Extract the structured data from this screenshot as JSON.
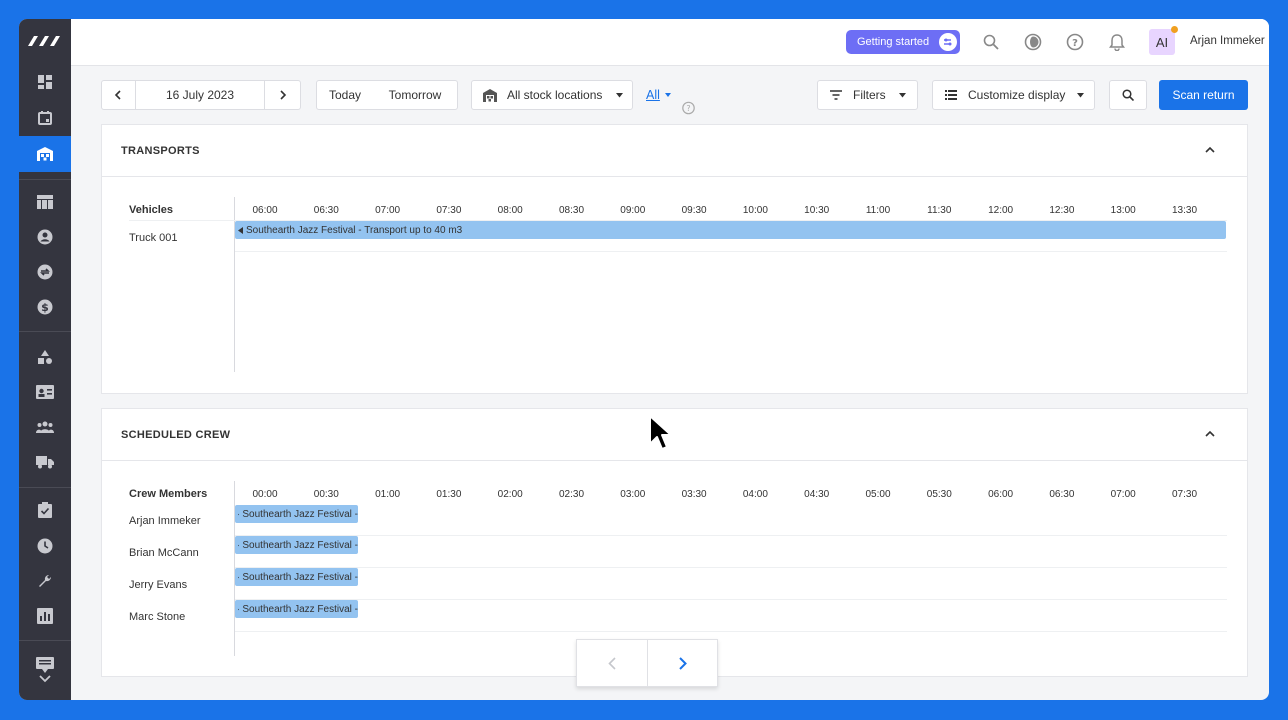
{
  "topbar": {
    "getting_started": "Getting started",
    "avatar_initials": "AI",
    "user_name": "Arjan Immeker"
  },
  "toolbar": {
    "date": "16 July 2023",
    "today": "Today",
    "tomorrow": "Tomorrow",
    "stock_locations": "All stock locations",
    "all_filter": "All",
    "filters": "Filters",
    "customize_display": "Customize display",
    "scan_return": "Scan return"
  },
  "transports": {
    "title": "TRANSPORTS",
    "row_header": "Vehicles",
    "times": [
      "06:00",
      "06:30",
      "07:00",
      "07:30",
      "08:00",
      "08:30",
      "09:00",
      "09:30",
      "10:00",
      "10:30",
      "11:00",
      "11:30",
      "12:00",
      "12:30",
      "13:00",
      "13:30"
    ],
    "rows": [
      {
        "name": "Truck 001",
        "bar": "Southearth Jazz Festival - Transport up to 40 m3"
      }
    ]
  },
  "crew": {
    "title": "SCHEDULED CREW",
    "row_header": "Crew Members",
    "times": [
      "00:00",
      "00:30",
      "01:00",
      "01:30",
      "02:00",
      "02:30",
      "03:00",
      "03:30",
      "04:00",
      "04:30",
      "05:00",
      "05:30",
      "06:00",
      "06:30",
      "07:00",
      "07:30"
    ],
    "rows": [
      {
        "name": "Arjan Immeker",
        "bar": "Southearth Jazz Festival -"
      },
      {
        "name": "Brian McCann",
        "bar": "Southearth Jazz Festival -"
      },
      {
        "name": "Jerry Evans",
        "bar": "Southearth Jazz Festival -"
      },
      {
        "name": "Marc Stone",
        "bar": "Southearth Jazz Festival -"
      }
    ]
  },
  "colors": {
    "accent": "#1a73e8",
    "sidebar": "#34353f",
    "bar": "#93c3f0",
    "getting_started": "#6d6ef5"
  }
}
